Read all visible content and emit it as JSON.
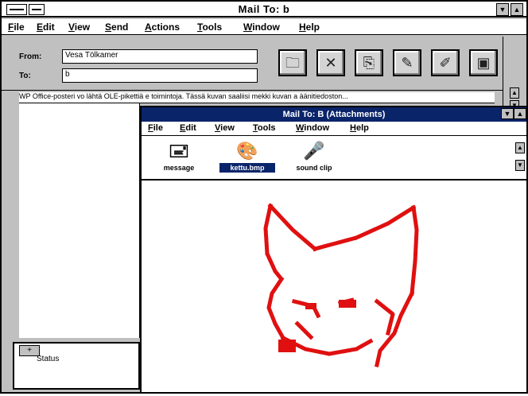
{
  "outer": {
    "title": "Mail To: b",
    "menu": [
      "File",
      "Edit",
      "View",
      "Send",
      "Actions",
      "Tools",
      "Window",
      "Help"
    ],
    "from_label": "From:",
    "from_value": "Vesa Tölkamer",
    "to_label": "To:",
    "to_value": "b",
    "body_line": "WP Office-posteri vo lähtä OLE-pikettiä e toimintoja. Tässä kuvan saaliisi mekki kuvan a äänitiedoston...",
    "status_button": "+",
    "status_label": "Status"
  },
  "toolbar_icons": [
    "address-book-icon",
    "delete-icon",
    "attach-icon",
    "paint-icon",
    "pen-icon",
    "save-icon"
  ],
  "inner": {
    "title": "Mail To: B (Attachments)",
    "menu": [
      "File",
      "Edit",
      "View",
      "Tools",
      "Window",
      "Help"
    ],
    "attachments": [
      {
        "label": "message",
        "icon": "message-icon",
        "selected": false
      },
      {
        "label": "kettu.bmp",
        "icon": "palette-icon",
        "selected": true
      },
      {
        "label": "sound clip",
        "icon": "microphone-icon",
        "selected": false
      }
    ]
  },
  "colors": {
    "drawing": "#e01010",
    "selection": "#0a246a",
    "chrome": "#c0c0c0"
  }
}
